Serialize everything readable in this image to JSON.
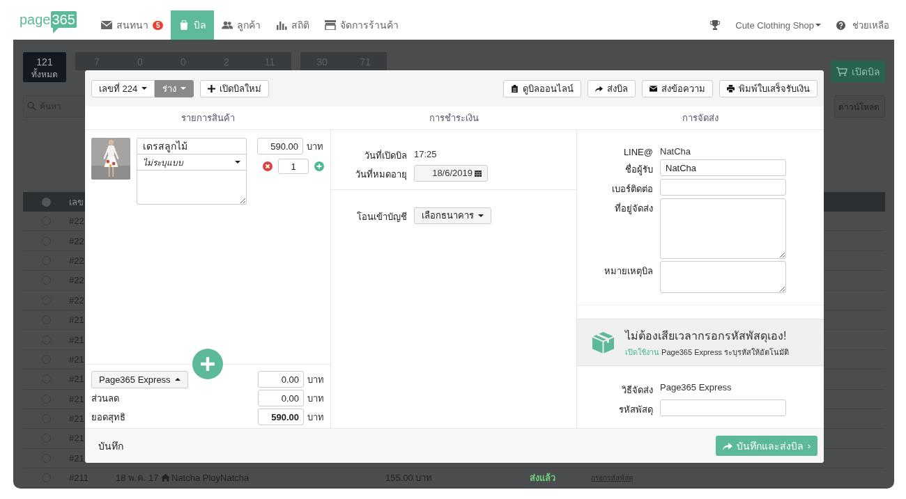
{
  "nav": {
    "logo": {
      "word": "page",
      "number": "365"
    },
    "items": [
      {
        "label": "สนทนา",
        "badge": "5",
        "selected": false
      },
      {
        "label": "บิล",
        "selected": true
      },
      {
        "label": "ลูกค้า",
        "selected": false
      },
      {
        "label": "สถิติ",
        "selected": false
      },
      {
        "label": "จัดการร้านค้า",
        "selected": false
      }
    ],
    "shop_menu": "Cute Clothing Shop",
    "help": "ช่วยเหลือ"
  },
  "background": {
    "stat_groups": [
      {
        "selected": true,
        "items": [
          {
            "value": "121",
            "label": "ทั้งหมด"
          }
        ]
      },
      {
        "selected": false,
        "items": [
          {
            "value": "7"
          },
          {
            "value": "0"
          },
          {
            "value": "0"
          },
          {
            "value": "2"
          },
          {
            "value": "11"
          }
        ]
      },
      {
        "selected": false,
        "items": [
          {
            "value": "30"
          },
          {
            "value": "71"
          }
        ]
      }
    ],
    "open_bill_button": "เปิดบิล",
    "search": {
      "placeholder": "ค้นหา"
    },
    "download_menu": "ดาวน์โหลด",
    "table": {
      "columns": [
        "เลข"
      ],
      "all_selected": false,
      "rows": [
        {
          "selected": false,
          "cells": [
            "#22"
          ]
        },
        {
          "selected": false,
          "cells": [
            "#22"
          ]
        },
        {
          "selected": false,
          "cells": [
            "#22"
          ]
        },
        {
          "selected": false,
          "cells": [
            "#22"
          ]
        },
        {
          "selected": false,
          "cells": [
            "#22"
          ]
        },
        {
          "selected": false,
          "cells": [
            "#21"
          ]
        },
        {
          "selected": false,
          "cells": [
            "#21"
          ]
        },
        {
          "selected": false,
          "cells": [
            "#21"
          ]
        },
        {
          "selected": false,
          "cells": [
            "#21"
          ]
        },
        {
          "selected": false,
          "cells": [
            "#21"
          ]
        },
        {
          "selected": false,
          "cells": [
            "#21"
          ]
        },
        {
          "selected": false,
          "cells": [
            "#21"
          ]
        },
        {
          "selected": false,
          "cells": [
            "#21"
          ]
        },
        {
          "selected": false,
          "cells": [
            "#211",
            "18 พ.ค. 17",
            "Natcha PloyNatcha",
            "155.00 บาท",
            "ส่งแล้ว",
            "กรอกรหัสพัสดุ"
          ]
        }
      ]
    }
  },
  "bill": {
    "number_menu": "เลขที่ 224",
    "status_menu": "ร่าง",
    "new_bill": "เปิดบิลใหม่",
    "actions": [
      "ดูบิลออนไลน์",
      "ส่งบิล",
      "ส่งข้อความ",
      "พิมพ์ใบเสร็จรับเงิน"
    ],
    "sections": [
      "รายการสินค้า",
      "การชำระเงิน",
      "การจัดส่ง"
    ],
    "items": [
      {
        "name": "เดรสลูกไม้",
        "variant": "ไม่ระบุแบบ",
        "price": "590.00",
        "currency": "บาท",
        "quantity": "1"
      }
    ],
    "totals": [
      {
        "kind": "menu",
        "label": "Page365 Express",
        "value": "0.00",
        "currency": "บาท"
      },
      {
        "kind": "label",
        "label": "ส่วนลด",
        "value": "0.00",
        "currency": "บาท"
      },
      {
        "kind": "total",
        "label": "ยอดสุทธิ",
        "value": "590.00",
        "currency": "บาท"
      }
    ],
    "payment": {
      "opened_label": "วันที่เปิดบิล",
      "opened": "17:25",
      "expiry_label": "วันที่หมดอายุ",
      "expiry": "18/6/2019",
      "transfer_label": "โอนเข้าบัญชี",
      "bank_menu": "เลือกธนาคาร"
    },
    "shipping": {
      "line_label": "LINE@",
      "line_value": "NatCha",
      "fields": [
        {
          "label": "ชื่อผู้รับ",
          "value": "NatCha",
          "kind": "input"
        },
        {
          "label": "เบอร์ติดต่อ",
          "kind": "input"
        },
        {
          "label": "ที่อยู่จัดส่ง",
          "kind": "tall-area"
        },
        {
          "label": "หมายเหตุบิล",
          "kind": "area"
        }
      ],
      "promo": {
        "title": "ไม่ต้องเสียเวลากรอกรหัสพัสดุเอง!",
        "link": "เปิดใช้งาน",
        "text": "Page365 Express ระบุรหัสให้อัตโนมัติ"
      },
      "method_label": "วิธีจัดส่ง",
      "method": "Page365 Express",
      "tracking_label": "รหัสพัสดุ"
    },
    "footer": {
      "save": "บันทึก",
      "save_send": "บันทึกและส่งบิล",
      "chevron": "›"
    }
  }
}
